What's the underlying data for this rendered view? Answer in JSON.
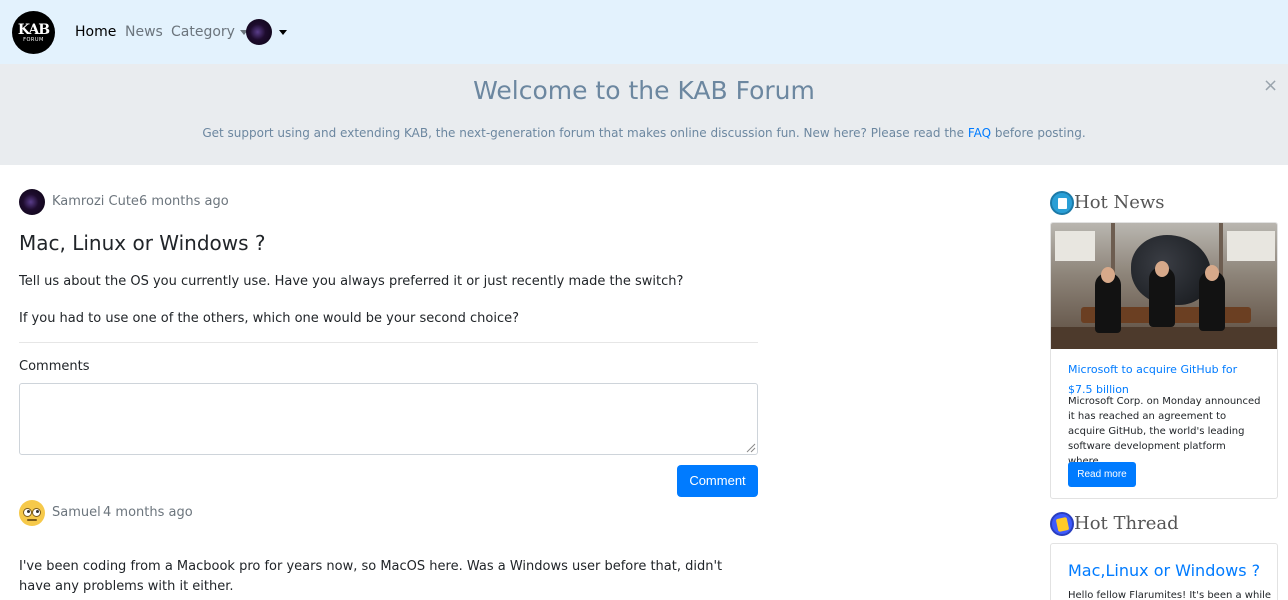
{
  "navbar": {
    "logo_text": "KAB",
    "logo_sub": "FORUM",
    "home": "Home",
    "news": "News",
    "category": "Category"
  },
  "banner": {
    "title": "Welcome to the KAB Forum",
    "text_before": "Get support using and extending KAB, the next-generation forum that makes online discussion fun. New here? Please read the ",
    "faq_link": "FAQ",
    "text_after": " before posting.",
    "close": "×"
  },
  "post": {
    "author": "Kamrozi Cute",
    "time": "6 months ago",
    "title": "Mac, Linux or Windows ?",
    "body_1": "Tell us about the OS you currently use. Have you always preferred it or just recently made the switch?",
    "body_2": "If you had to use one of the others, which one would be your second choice?"
  },
  "comment_form": {
    "label": "Comments",
    "value": "",
    "button": "Comment"
  },
  "reply": {
    "author": "Samuel",
    "time": "4 months ago",
    "body": "I've been coding from a Macbook pro for years now, so MacOS here. Was a Windows user before that, didn't have any problems with it either."
  },
  "sidebar": {
    "hot_news": {
      "heading": "Hot News",
      "title": "Microsoft to acquire GitHub for $7.5 billion",
      "text": "Microsoft Corp. on Monday announced it has reached an agreement to acquire GitHub, the world's leading software development platform where...",
      "button": "Read more"
    },
    "hot_thread": {
      "heading": "Hot Thread",
      "title": "Mac,Linux or Windows ?",
      "text": "Hello fellow Flarumites! It's been a while"
    }
  },
  "colors": {
    "navbar_bg": "#e3f2fd",
    "banner_bg": "#e9ecef",
    "primary": "#007bff",
    "muted": "#6c757d"
  }
}
